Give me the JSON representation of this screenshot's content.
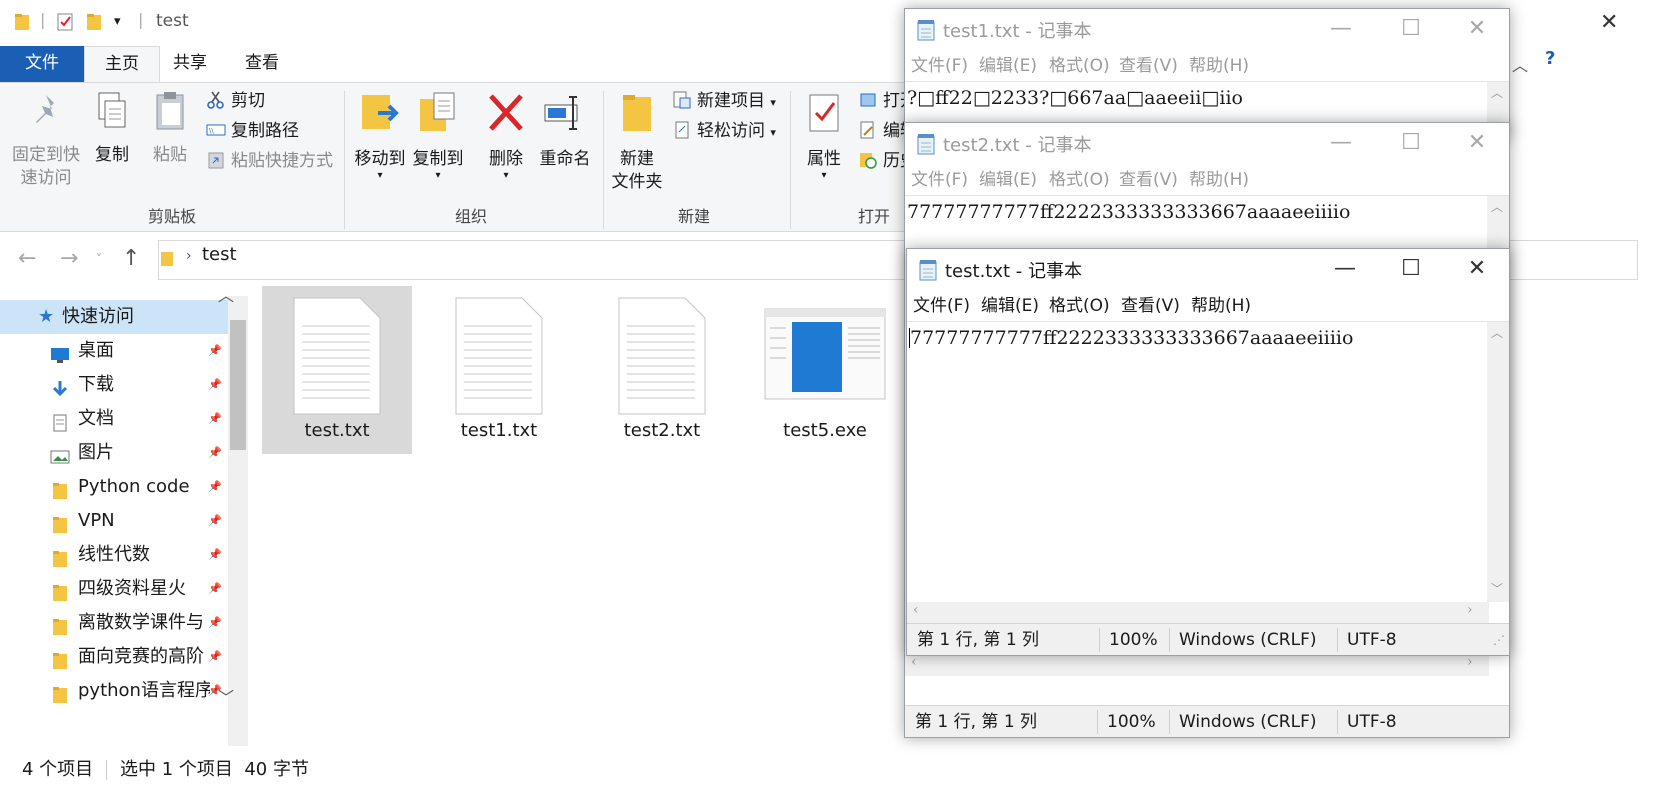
{
  "explorer": {
    "title": "test",
    "tabs": {
      "file": "文件",
      "home": "主页",
      "share": "共享",
      "view": "查看"
    },
    "clipboard": {
      "pin": "固定到快\n速访问",
      "pin_l1": "固定到快",
      "pin_l2": "速访问",
      "copy": "复制",
      "paste": "粘贴",
      "cut": "剪切",
      "copy_path": "复制路径",
      "paste_shortcut": "粘贴快捷方式",
      "group": "剪贴板"
    },
    "organize": {
      "move_to": "移动到",
      "copy_to": "复制到",
      "delete": "删除",
      "rename": "重命名",
      "group": "组织"
    },
    "new": {
      "new_folder_l1": "新建",
      "new_folder_l2": "文件夹",
      "new_item": "新建项目",
      "easy_access": "轻松访问",
      "group": "新建"
    },
    "open": {
      "properties": "属性",
      "open": "打开",
      "edit": "编辑",
      "history": "历史",
      "group": "打开"
    },
    "address": "test",
    "sidebar": {
      "quick_access": "快速访问",
      "items": [
        {
          "label": "桌面",
          "icon": "desktop-icon"
        },
        {
          "label": "下载",
          "icon": "download-icon"
        },
        {
          "label": "文档",
          "icon": "document-icon"
        },
        {
          "label": "图片",
          "icon": "picture-icon"
        },
        {
          "label": "Python code",
          "icon": "folder-icon"
        },
        {
          "label": "VPN",
          "icon": "folder-icon"
        },
        {
          "label": "线性代数",
          "icon": "folder-icon"
        },
        {
          "label": "四级资料星火",
          "icon": "folder-icon"
        },
        {
          "label": "离散数学课件与",
          "icon": "folder-icon"
        },
        {
          "label": "面向竞赛的高阶",
          "icon": "folder-icon"
        },
        {
          "label": "python语言程序",
          "icon": "folder-icon"
        }
      ]
    },
    "files": [
      {
        "name": "test.txt",
        "selected": true
      },
      {
        "name": "test1.txt",
        "selected": false
      },
      {
        "name": "test2.txt",
        "selected": false
      },
      {
        "name": "test5.exe",
        "selected": false
      }
    ],
    "status": {
      "count": "4 个项目",
      "selection": "选中 1 个项目  40 字节"
    }
  },
  "notepad": {
    "menu": [
      "文件(F)",
      "编辑(E)",
      "格式(O)",
      "查看(V)",
      "帮助(H)"
    ],
    "windows": [
      {
        "title": "test1.txt - 记事本",
        "text": "?□ff22□2233?□667aa□aaeeii□iio"
      },
      {
        "title": "test2.txt - 记事本",
        "text": "77777777777ff2222333333333667aaaaeeiiiio"
      },
      {
        "title": "test.txt - 记事本",
        "text": "77777777777ff2222333333333667aaaaeeiiiio"
      }
    ],
    "status": {
      "position": "第 1 行, 第 1 列",
      "zoom": "100%",
      "eol": "Windows (CRLF)",
      "encoding": "UTF-8"
    }
  },
  "colors": {
    "file_tab": "#1a5fb4",
    "selection": "#d9d9d9",
    "quick_access_bg": "#cce4f7",
    "delete_red": "#d9262a"
  }
}
